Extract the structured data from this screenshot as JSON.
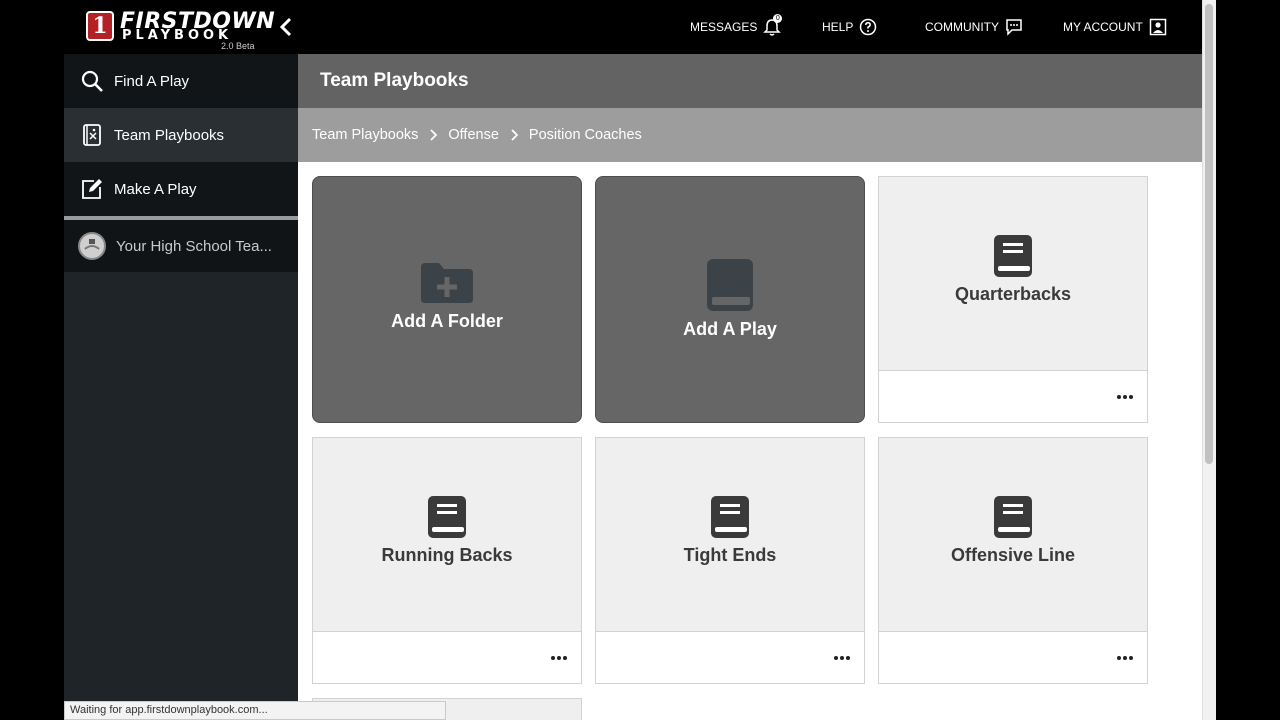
{
  "brand": {
    "word1": "FIRSTDOWN",
    "word2": "PLAYBOOK",
    "badge": "1",
    "version": "2.0 Beta"
  },
  "topnav": {
    "messages": "MESSAGES",
    "messages_count": "0",
    "help": "HELP",
    "community": "COMMUNITY",
    "account": "MY ACCOUNT"
  },
  "sidebar": {
    "items": [
      {
        "label": "Find A Play",
        "icon": "search-icon"
      },
      {
        "label": "Team Playbooks",
        "icon": "playbook-icon"
      },
      {
        "label": "Make A Play",
        "icon": "edit-icon"
      }
    ],
    "team": "Your High School Tea..."
  },
  "main": {
    "title": "Team Playbooks",
    "breadcrumb": [
      "Team Playbooks",
      "Offense",
      "Position Coaches"
    ],
    "actions": {
      "add_folder": "Add A Folder",
      "add_play": "Add A Play"
    },
    "folders": [
      "Quarterbacks",
      "Running Backs",
      "Tight Ends",
      "Offensive Line"
    ]
  },
  "status": "Waiting for app.firstdownplaybook.com...",
  "colors": {
    "title_bar": "#636363",
    "breadcrumb_bar": "#9d9d9d",
    "action_card": "#666666",
    "folder_card": "#efefef",
    "brand_red": "#b32026"
  }
}
